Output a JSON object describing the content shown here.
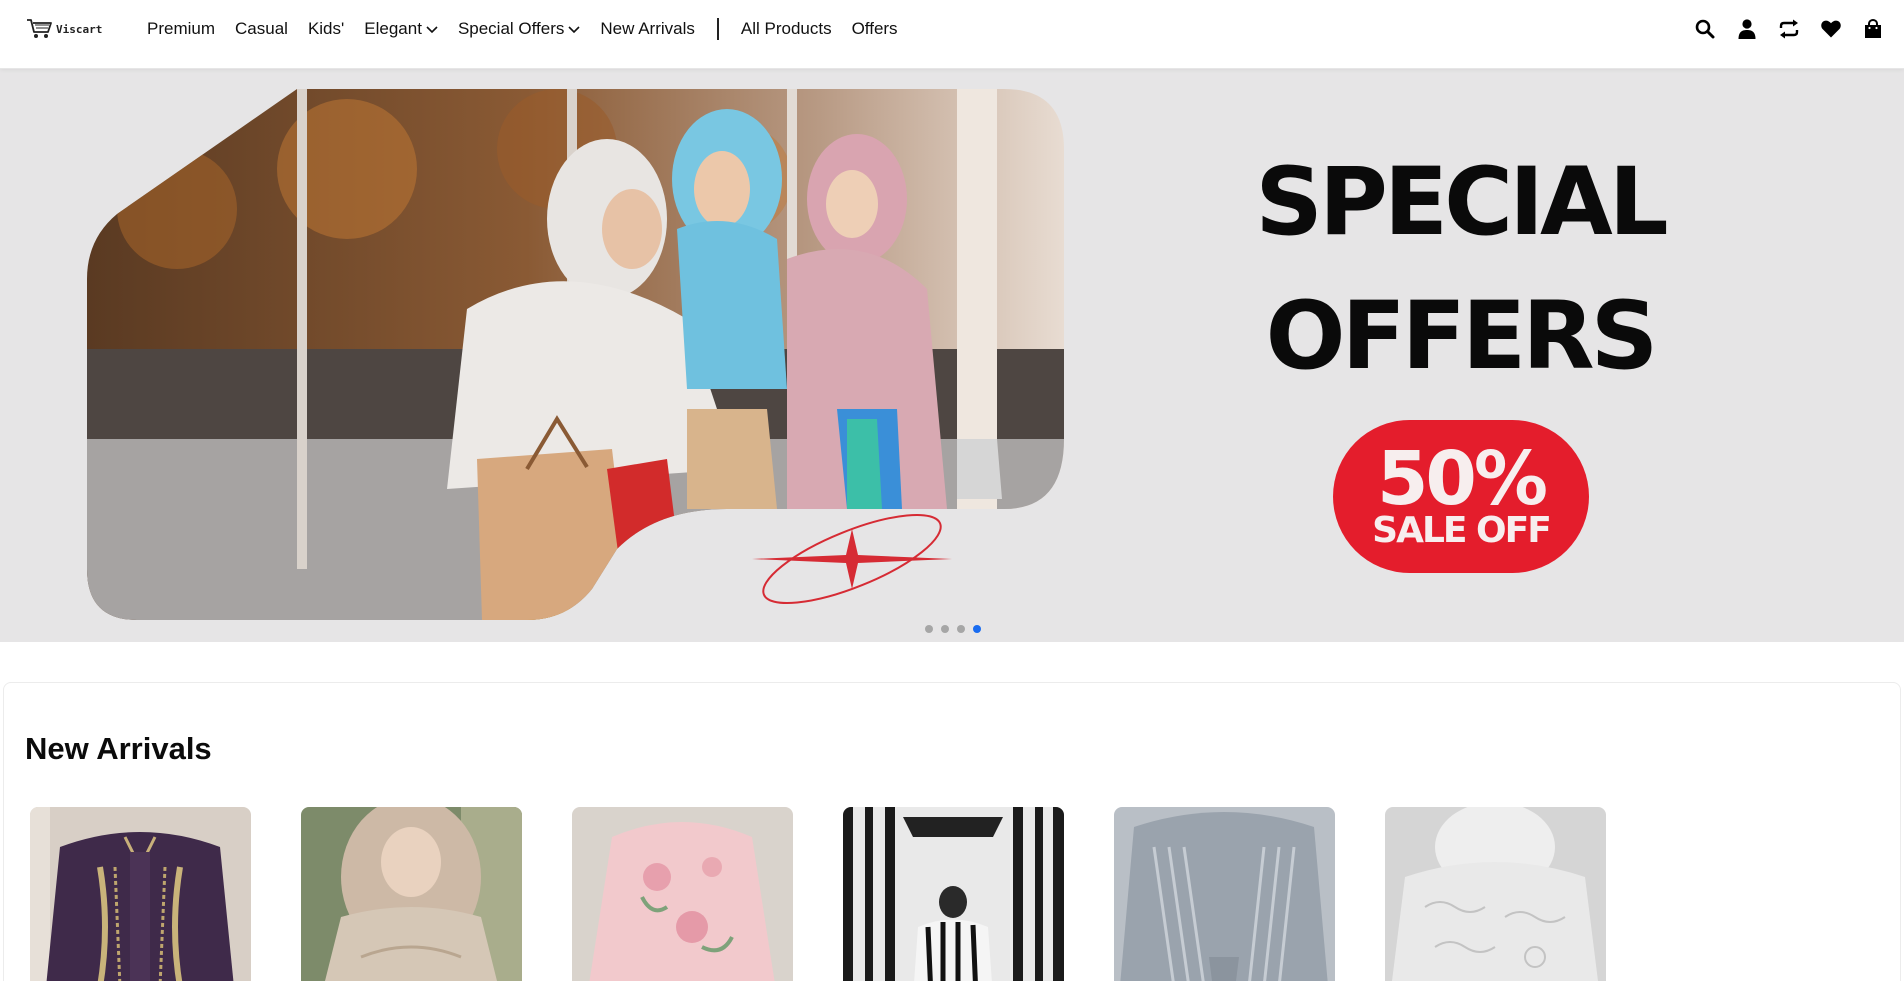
{
  "brand": {
    "name": "Viscart",
    "logo_icon": "shopping-cart-icon"
  },
  "nav": {
    "items": [
      {
        "label": "Premium",
        "has_dropdown": false
      },
      {
        "label": "Casual",
        "has_dropdown": false
      },
      {
        "label": "Kids'",
        "has_dropdown": false
      },
      {
        "label": "Elegant",
        "has_dropdown": true
      },
      {
        "label": "Special Offers",
        "has_dropdown": true
      },
      {
        "label": "New Arrivals",
        "has_dropdown": false
      }
    ],
    "secondary": [
      {
        "label": "All Products"
      },
      {
        "label": "Offers"
      }
    ]
  },
  "actions": [
    {
      "icon": "search-icon"
    },
    {
      "icon": "user-icon"
    },
    {
      "icon": "compare-icon"
    },
    {
      "icon": "heart-icon"
    },
    {
      "icon": "shopping-bag-icon"
    }
  ],
  "hero": {
    "title_line1": "SPECIAL",
    "title_line2": "OFFERS",
    "sale_percent": "50%",
    "sale_text": "SALE OFF",
    "slides_count": 4,
    "active_slide": 4,
    "colors": {
      "background": "#e6e5e6",
      "badge": "#e41d2c",
      "active_dot": "#1a6cf0"
    }
  },
  "new_arrivals": {
    "title": "New Arrivals",
    "products": [
      {
        "image": "purple-embroidered-dress"
      },
      {
        "image": "beige-hijab-outfit"
      },
      {
        "image": "pink-floral-abaya"
      },
      {
        "image": "striped-shirt-mannequin"
      },
      {
        "image": "grey-pleated-hijab"
      },
      {
        "image": "white-lace-hijab"
      }
    ]
  }
}
